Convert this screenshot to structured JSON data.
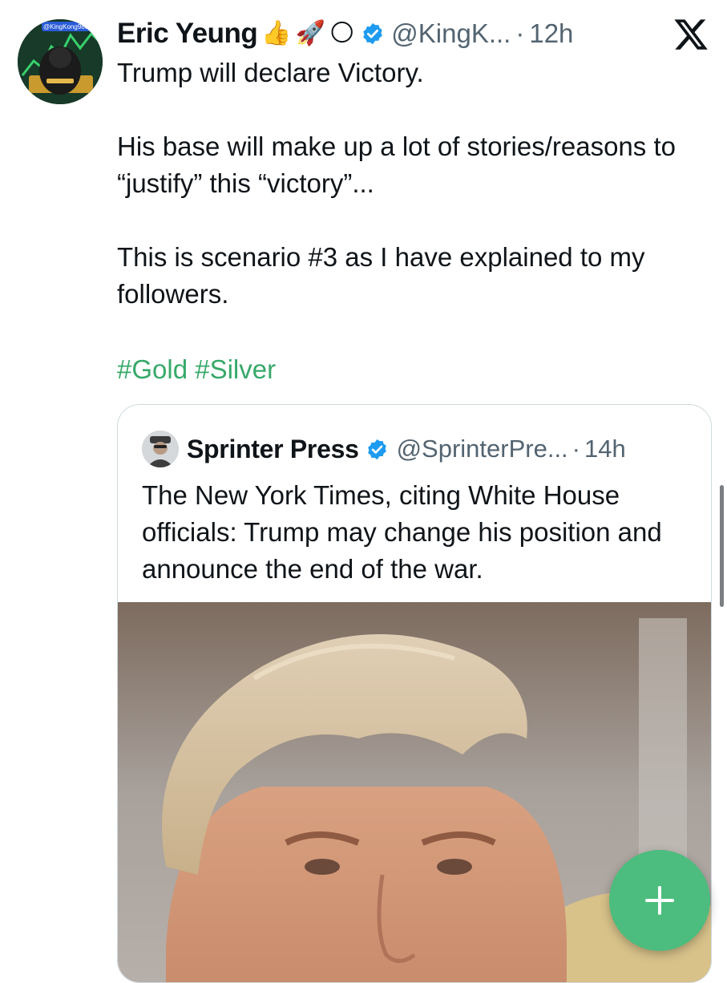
{
  "author": {
    "name": "Eric Yeung",
    "emojis": [
      "👍",
      "🚀",
      "🌕"
    ],
    "handle": "@KingK...",
    "time": "12h",
    "avatar_text": "@KingKong9888"
  },
  "tweet": {
    "lines": [
      "Trump will declare Victory.",
      "His base will make up a lot of stories/reasons to “justify” this “victory”...",
      "This is scenario #3 as I have explained to my followers."
    ],
    "hashtags": [
      "#Gold",
      "#Silver"
    ]
  },
  "quote": {
    "name": "Sprinter Press",
    "handle": "@SprinterPre...",
    "time": "14h",
    "text": "The New York Times, citing White House officials: Trump may change his position and announce the end of the war."
  },
  "fab": {
    "icon": "plus-icon",
    "symbol": "+"
  },
  "colors": {
    "verified": "#1d9bf0",
    "hashtag": "#37a96a",
    "fab": "#4cbd7e",
    "secondary_text": "#536471"
  }
}
